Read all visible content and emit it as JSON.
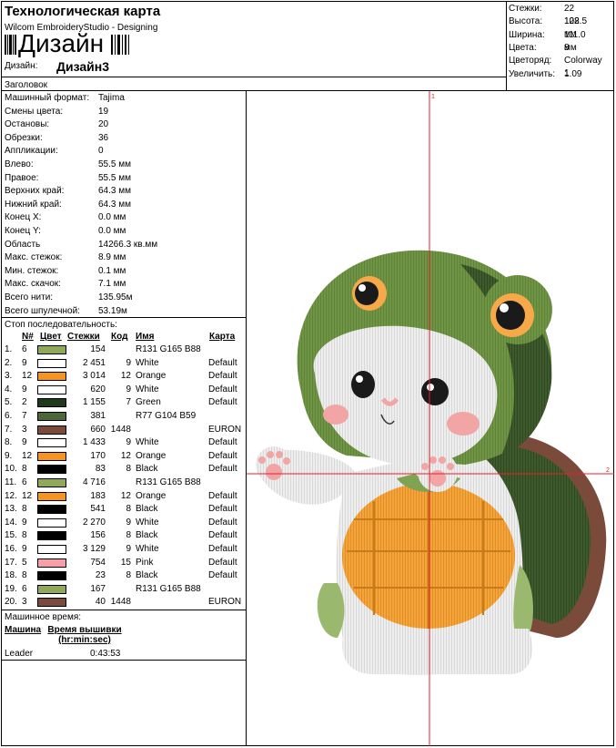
{
  "header": {
    "title": "Технологическая карта",
    "subtitle": "Wilcom EmbroideryStudio - Designing",
    "big_name": "Дизайн",
    "design_label": "Дизайн:",
    "design_value": "Дизайн3",
    "heading_label": "Заголовок"
  },
  "summary": [
    {
      "k": "Стежки:",
      "v": "22 102"
    },
    {
      "k": "Высота:",
      "v": "128.5 мм"
    },
    {
      "k": "Ширина:",
      "v": "111.0 мм"
    },
    {
      "k": "Цвета:",
      "v": "8"
    },
    {
      "k": "Цветоряд:",
      "v": "Colorway 1"
    },
    {
      "k": "Увеличить:",
      "v": "1.09"
    }
  ],
  "machine_info": [
    {
      "k": "Машинный формат:",
      "v": "Tajima"
    },
    {
      "k": "Смены цвета:",
      "v": "19"
    },
    {
      "k": "Остановы:",
      "v": "20"
    },
    {
      "k": "Обрезки:",
      "v": "36"
    },
    {
      "k": "Аппликации:",
      "v": "0"
    },
    {
      "k": "Влево:",
      "v": "55.5 мм"
    },
    {
      "k": "Правое:",
      "v": "55.5 мм"
    },
    {
      "k": "Верхних край:",
      "v": "64.3 мм"
    },
    {
      "k": "Нижний край:",
      "v": "64.3 мм"
    },
    {
      "k": "Конец X:",
      "v": "0.0 мм"
    },
    {
      "k": "Конец Y:",
      "v": "0.0 мм"
    },
    {
      "k": "Область",
      "v": "14266.3 кв.мм"
    },
    {
      "k": "Макс. стежок:",
      "v": "8.9 мм"
    },
    {
      "k": "Мин. стежок:",
      "v": "0.1 мм"
    },
    {
      "k": "Макс. скачок:",
      "v": "7.1 мм"
    },
    {
      "k": "Всего нити:",
      "v": "135.95м"
    },
    {
      "k": "Всего шпулечной:",
      "v": "53.19м"
    }
  ],
  "sequence": {
    "title": "Стоп последовательность:",
    "headers": {
      "num": "N#",
      "color": "Цвет",
      "stitches": "Стежки",
      "code": "Код",
      "name": "Имя",
      "chart": "Карта"
    },
    "rows": [
      {
        "i": "1.",
        "n": "6",
        "c": "#8fa85a",
        "s": "154",
        "code": "",
        "name": "R131 G165 B88",
        "chart": ""
      },
      {
        "i": "2.",
        "n": "9",
        "c": "#ffffff",
        "s": "2 451",
        "code": "9",
        "name": "White",
        "chart": "Default"
      },
      {
        "i": "3.",
        "n": "12",
        "c": "#f7941d",
        "s": "3 014",
        "code": "12",
        "name": "Orange",
        "chart": "Default"
      },
      {
        "i": "4.",
        "n": "9",
        "c": "#ffffff",
        "s": "620",
        "code": "9",
        "name": "White",
        "chart": "Default"
      },
      {
        "i": "5.",
        "n": "2",
        "c": "#1e3a1a",
        "s": "1 155",
        "code": "7",
        "name": "Green",
        "chart": "Default"
      },
      {
        "i": "6.",
        "n": "7",
        "c": "#4d6838",
        "s": "381",
        "code": "",
        "name": "R77 G104 B59",
        "chart": ""
      },
      {
        "i": "7.",
        "n": "3",
        "c": "#7a4a3a",
        "s": "660",
        "code": "1448",
        "name": "",
        "chart": "EURON"
      },
      {
        "i": "8.",
        "n": "9",
        "c": "#ffffff",
        "s": "1 433",
        "code": "9",
        "name": "White",
        "chart": "Default"
      },
      {
        "i": "9.",
        "n": "12",
        "c": "#f7941d",
        "s": "170",
        "code": "12",
        "name": "Orange",
        "chart": "Default"
      },
      {
        "i": "10.",
        "n": "8",
        "c": "#000000",
        "s": "83",
        "code": "8",
        "name": "Black",
        "chart": "Default"
      },
      {
        "i": "11.",
        "n": "6",
        "c": "#8fa85a",
        "s": "4 716",
        "code": "",
        "name": "R131 G165 B88",
        "chart": ""
      },
      {
        "i": "12.",
        "n": "12",
        "c": "#f7941d",
        "s": "183",
        "code": "12",
        "name": "Orange",
        "chart": "Default"
      },
      {
        "i": "13.",
        "n": "8",
        "c": "#000000",
        "s": "541",
        "code": "8",
        "name": "Black",
        "chart": "Default"
      },
      {
        "i": "14.",
        "n": "9",
        "c": "#ffffff",
        "s": "2 270",
        "code": "9",
        "name": "White",
        "chart": "Default"
      },
      {
        "i": "15.",
        "n": "8",
        "c": "#000000",
        "s": "156",
        "code": "8",
        "name": "Black",
        "chart": "Default"
      },
      {
        "i": "16.",
        "n": "9",
        "c": "#ffffff",
        "s": "3 129",
        "code": "9",
        "name": "White",
        "chart": "Default"
      },
      {
        "i": "17.",
        "n": "5",
        "c": "#f4a0a6",
        "s": "754",
        "code": "15",
        "name": "Pink",
        "chart": "Default"
      },
      {
        "i": "18.",
        "n": "8",
        "c": "#000000",
        "s": "23",
        "code": "8",
        "name": "Black",
        "chart": "Default"
      },
      {
        "i": "19.",
        "n": "6",
        "c": "#8fa85a",
        "s": "167",
        "code": "",
        "name": "R131 G165 B88",
        "chart": ""
      },
      {
        "i": "20.",
        "n": "3",
        "c": "#7a4a3a",
        "s": "40",
        "code": "1448",
        "name": "",
        "chart": "EURON"
      }
    ]
  },
  "machine_time": {
    "label": "Машинное время:",
    "col_machine": "Машина",
    "col_time_1": "Время вышивки",
    "col_time_2": "(hr:min:sec)",
    "machine": "Leader",
    "time": "0:43:53"
  },
  "artwork": {
    "marker_1": "1",
    "marker_2": "2",
    "crosshair_color": "#e8202a"
  }
}
